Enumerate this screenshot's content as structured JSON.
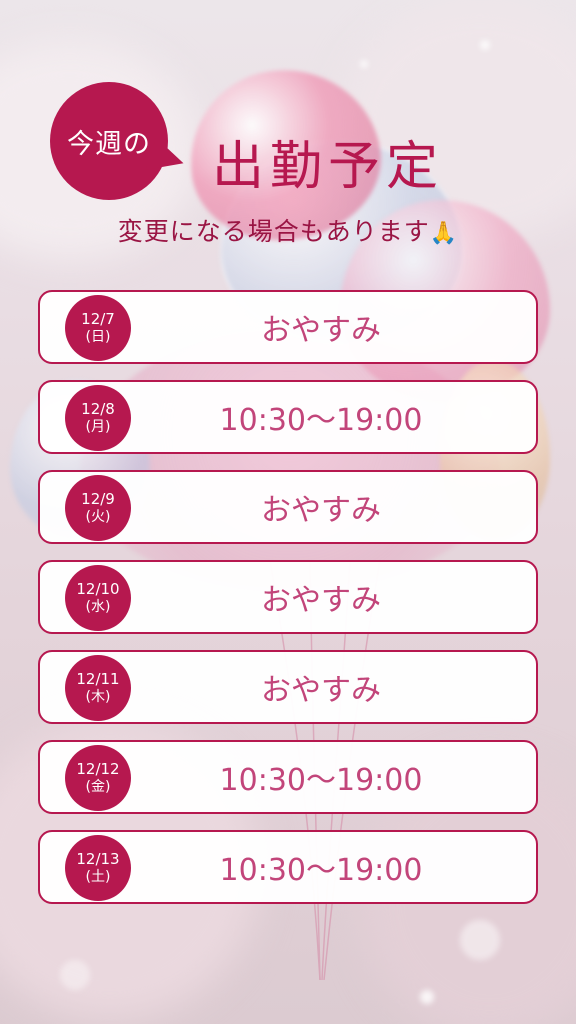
{
  "header": {
    "badge": "今週の",
    "title": "出勤予定",
    "subtitle": "変更になる場合もあります",
    "subtitle_emoji": "🙏"
  },
  "schedule": [
    {
      "date": "12/7",
      "day": "(日)",
      "value": "おやすみ"
    },
    {
      "date": "12/8",
      "day": "(月)",
      "value": "10:30〜19:00"
    },
    {
      "date": "12/9",
      "day": "(火)",
      "value": "おやすみ"
    },
    {
      "date": "12/10",
      "day": "(水)",
      "value": "おやすみ"
    },
    {
      "date": "12/11",
      "day": "(木)",
      "value": "おやすみ"
    },
    {
      "date": "12/12",
      "day": "(金)",
      "value": "10:30〜19:00"
    },
    {
      "date": "12/13",
      "day": "(土)",
      "value": "10:30〜19:00"
    }
  ],
  "colors": {
    "accent": "#b6184f",
    "value_text": "#c2457a",
    "card_bg": "#ffffff"
  }
}
